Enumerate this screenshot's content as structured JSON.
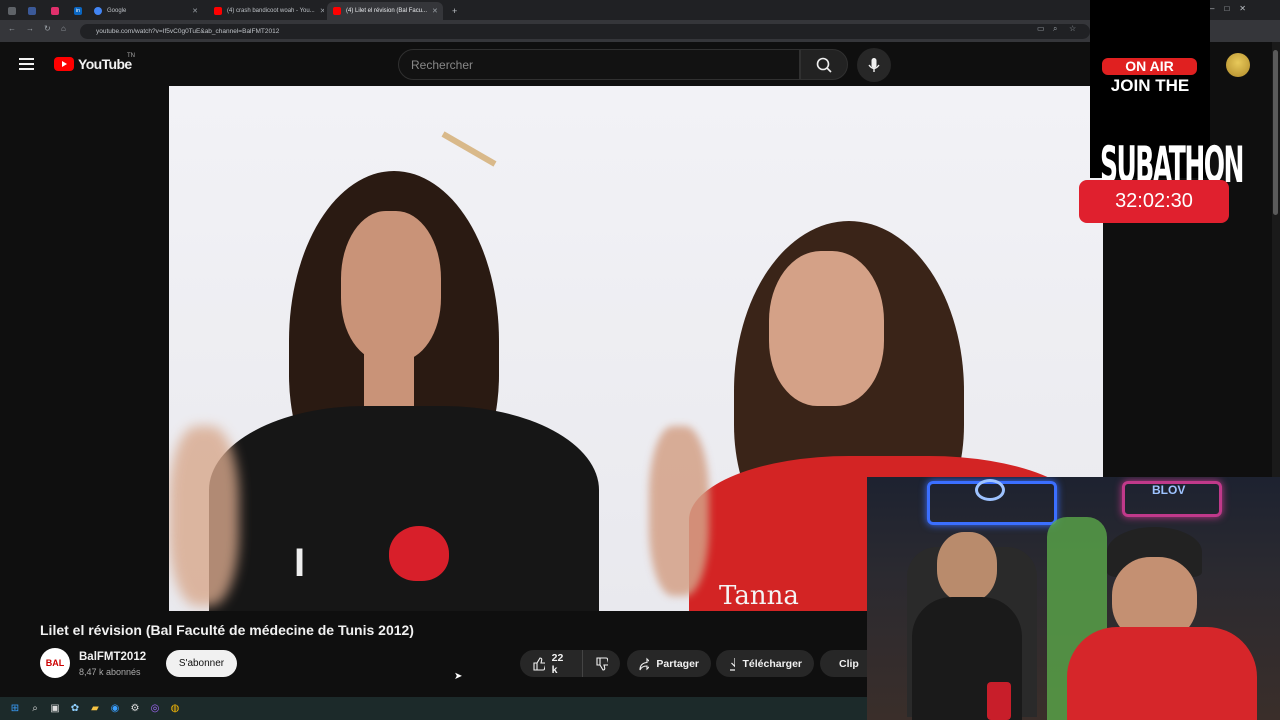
{
  "browser": {
    "tabs": [
      {
        "label": "",
        "color": "#5f6368"
      },
      {
        "label": "",
        "color": "#3b5998"
      },
      {
        "label": "",
        "color": "#e1306c"
      },
      {
        "label": "in",
        "color": "#0a66c2"
      },
      {
        "label": "Google",
        "color": "#4285f4"
      },
      {
        "label": "(4) crash bandicoot woah - You...",
        "color": "#ff0000"
      },
      {
        "label": "(4) Lilet el révision (Bal Facu...",
        "color": "#ff0000"
      }
    ],
    "new_tab": "+",
    "url": "youtube.com/watch?v=If5vC0g0TuE&ab_channel=BalFMT2012"
  },
  "youtube": {
    "logo_text": "YouTube",
    "country_code": "TN",
    "search_placeholder": "Rechercher"
  },
  "overlay": {
    "badge": "ON AIR",
    "line1": "JOIN THE",
    "line2": "SUBATHON",
    "timer": "32:02:30"
  },
  "video": {
    "title": "Lilet el révision (Bal Faculté de médecine de Tunis 2012)",
    "channel_avatar_text": "BAL",
    "channel_name": "BalFMT2012",
    "subscribers": "8,47 k abonnés",
    "subscribe_label": "S'abonner",
    "likes": "22 k",
    "share_label": "Partager",
    "download_label": "Télécharger",
    "clip_label": "Clip",
    "shirt_text": "I",
    "shirt_text_right": "Tanna"
  },
  "webcam": {
    "neon_sign": "BLOV"
  },
  "colors": {
    "accent_red": "#ff0000",
    "timer_red": "#e0202e",
    "background": "#0f0f0f"
  }
}
